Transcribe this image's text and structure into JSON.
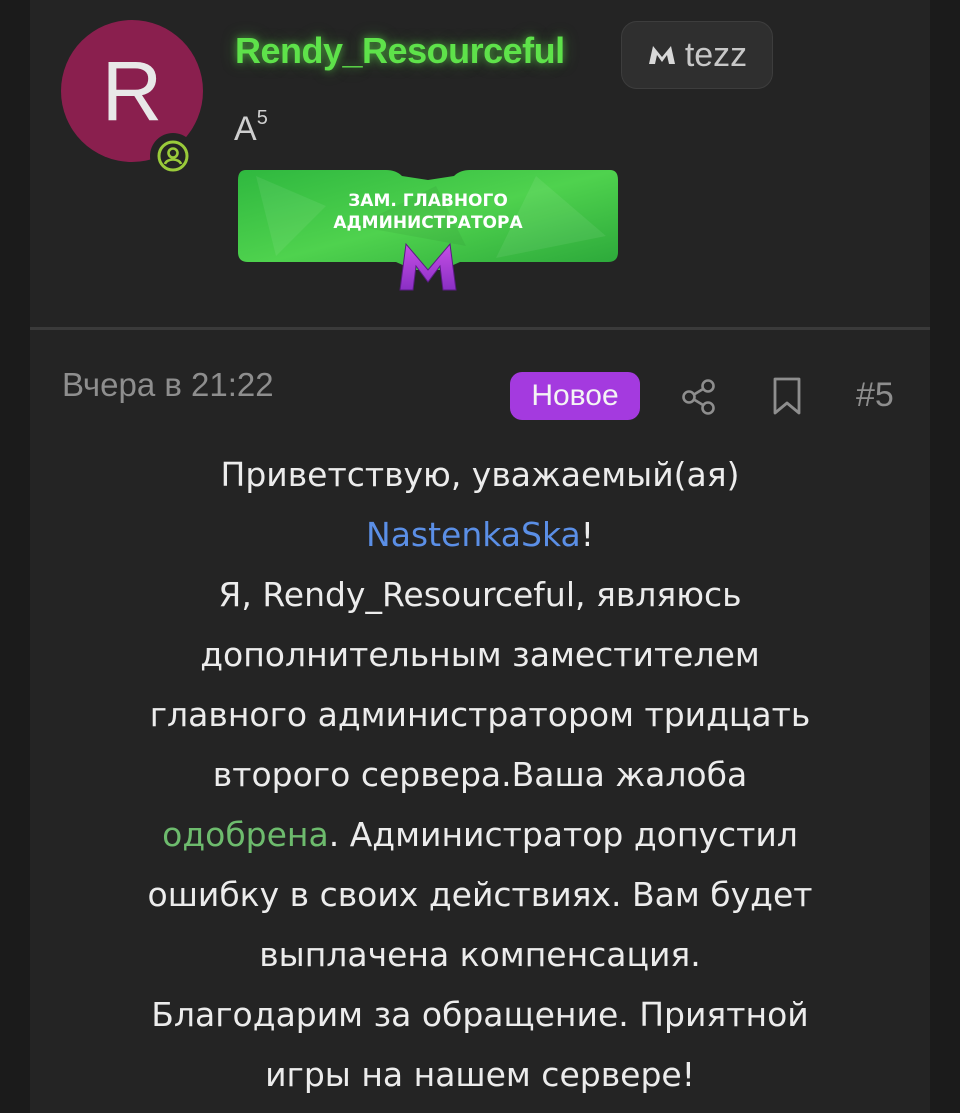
{
  "user": {
    "avatar_letter": "R",
    "avatar_color": "#8a1f4e",
    "username": "Rendy_Resourceful",
    "username_color": "#5ee24a",
    "server_tag": "tezz",
    "server_icon": "m-logo-icon",
    "rank_letter": "A",
    "rank_level": "5",
    "status_icon": "online-user-icon",
    "badge": {
      "line1": "ЗАМ. ГЛАВНОГО",
      "line2": "АДМИНИСТРАТОРА",
      "logo": "m-logo-icon"
    }
  },
  "post": {
    "date": "Вчера в 21:22",
    "new_label": "Новое",
    "number": "#5",
    "accent_color": "#a43adf",
    "message": {
      "greeting": "Приветствую, уважаемый(ая)",
      "mention": "NastenkaSka",
      "mention_suffix": "!",
      "l3": "Я, Rendy_Resourceful, являюсь",
      "l4": "дополнительным заместителем",
      "l5": "главного администратором тридцать",
      "l6": "второго сервера.Ваша жалоба",
      "approved": "одобрена",
      "l7_rest": ". Администратор допустил",
      "l8": "ошибку в своих действиях. Вам будет",
      "l9": "выплачена компенсация.",
      "l10": "Благодарим за обращение. Приятной",
      "l11": "игры на нашем сервере!"
    }
  }
}
